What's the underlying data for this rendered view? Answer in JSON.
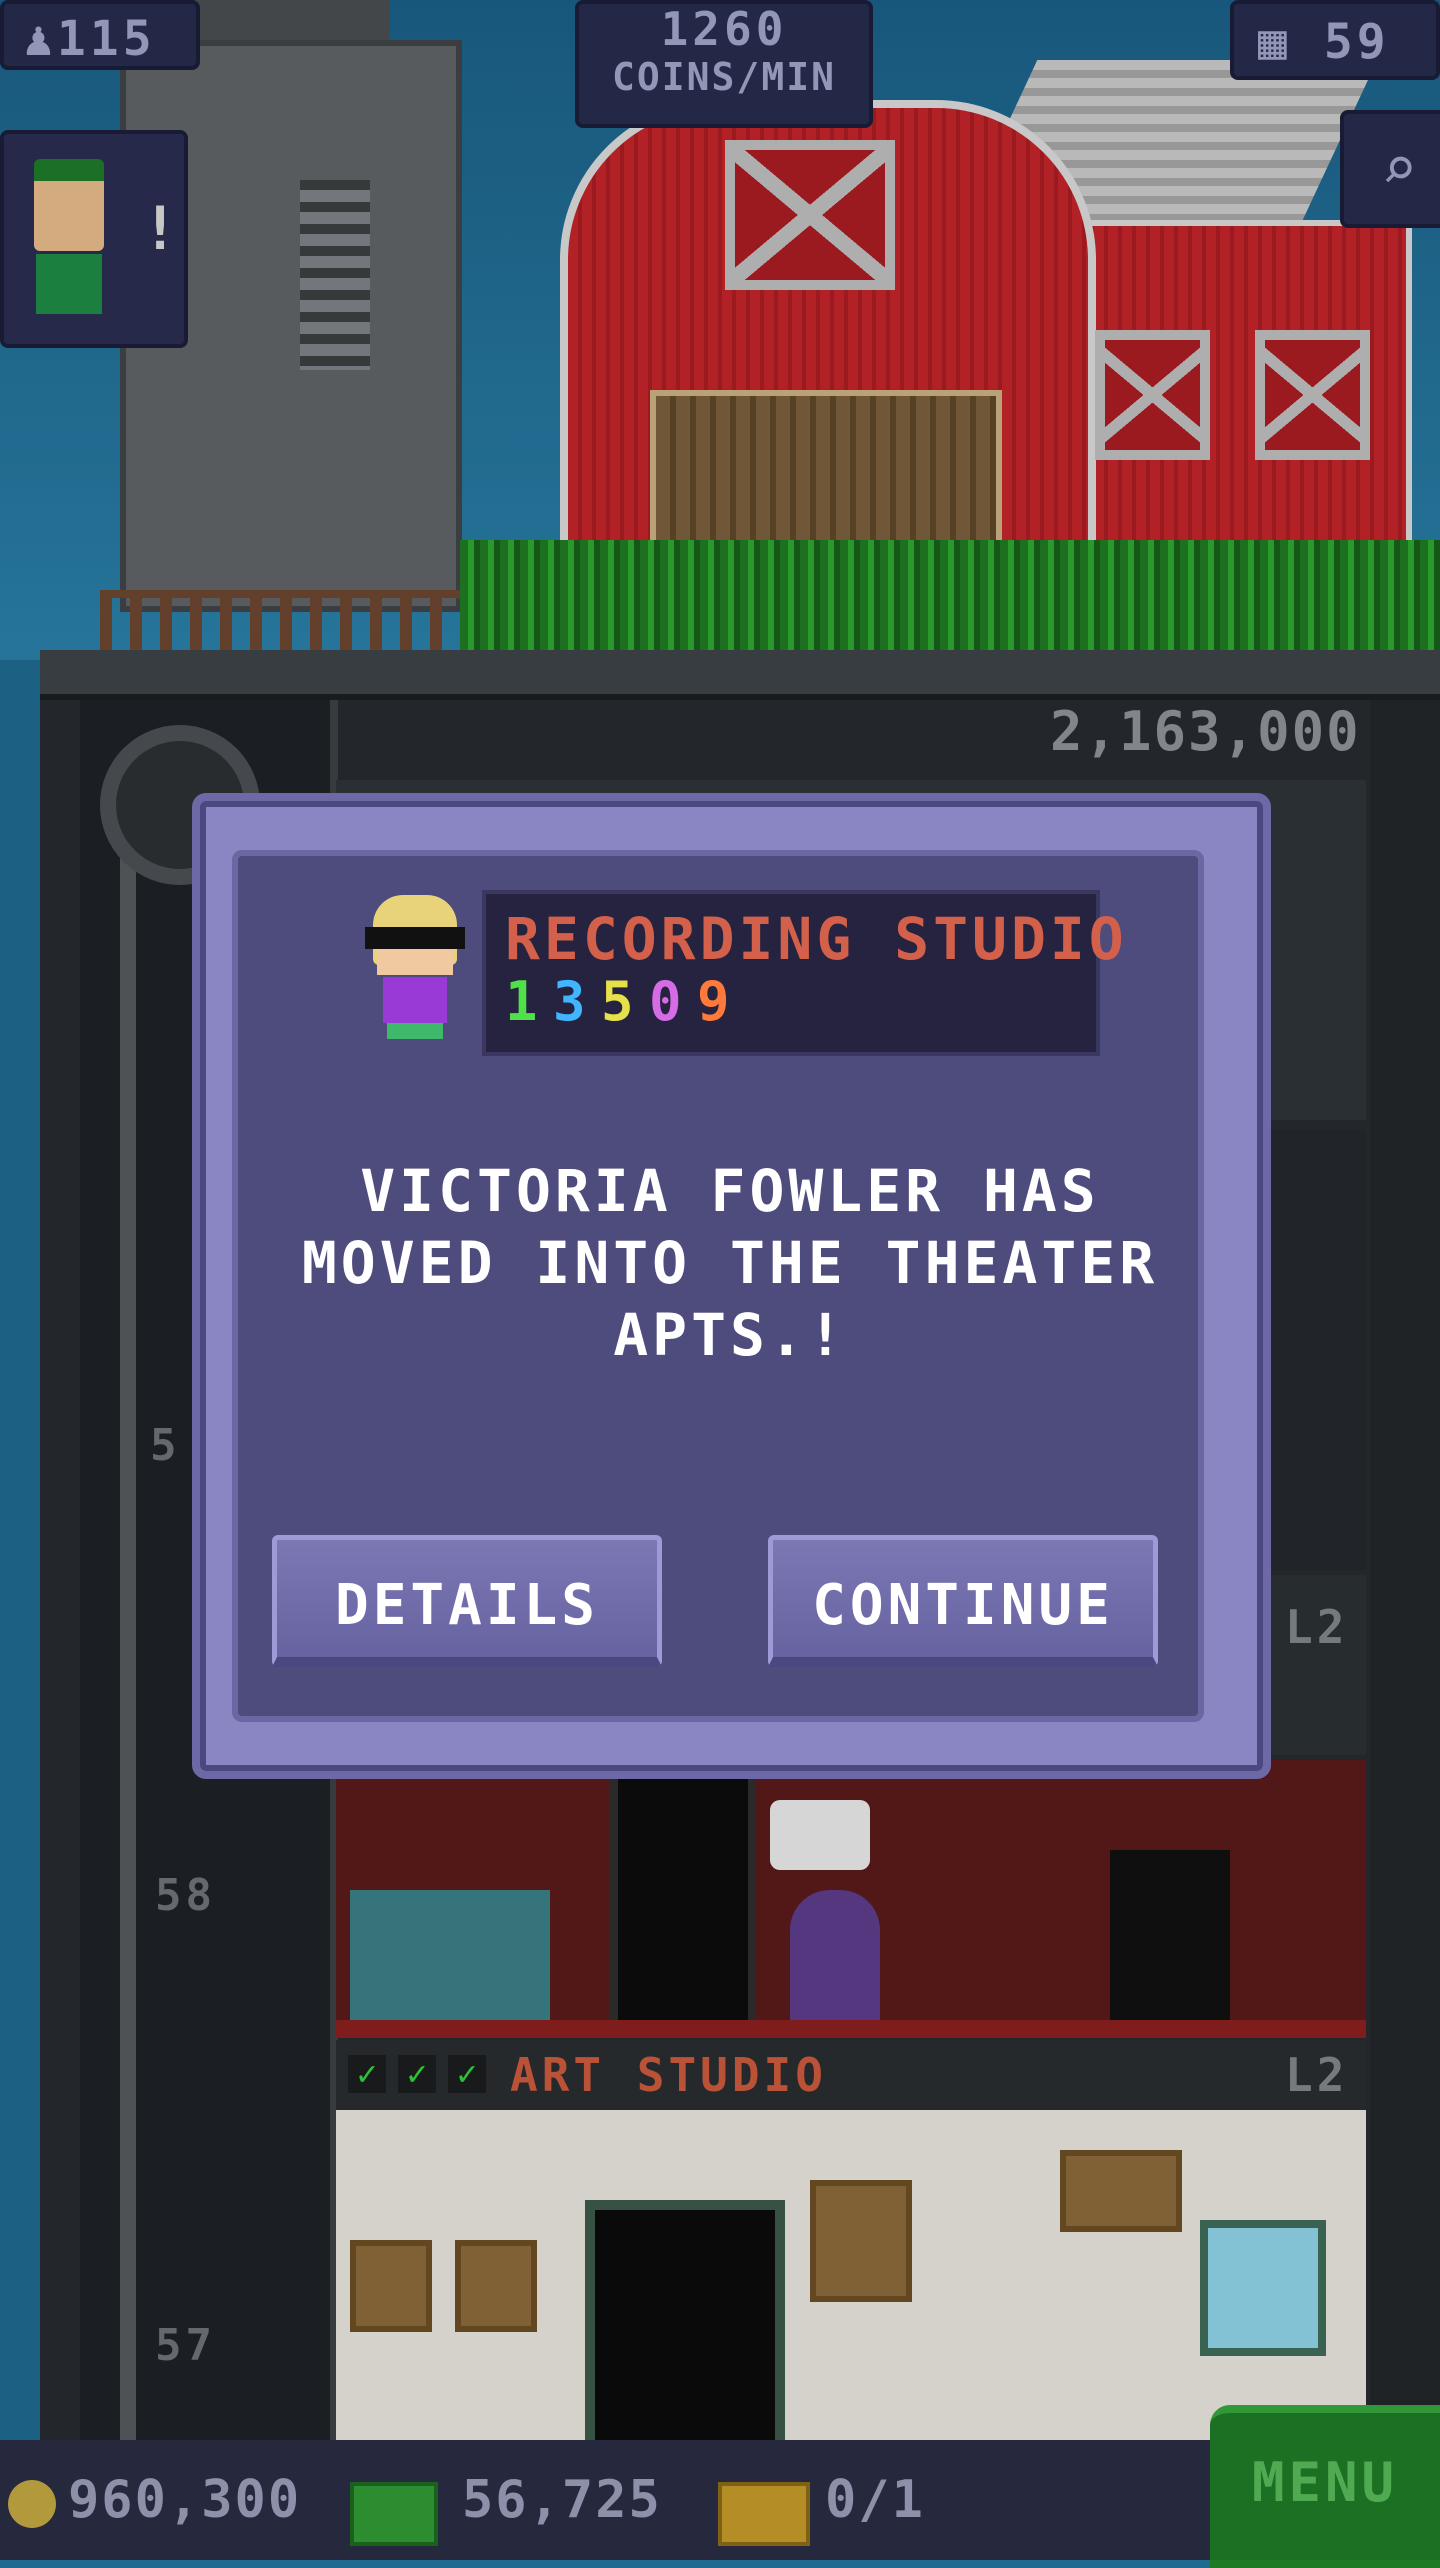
{
  "hud": {
    "population": "115",
    "coins_per_min_value": "1260",
    "coins_per_min_label": "COINS/MIN",
    "floors": "59",
    "coins": "960,300",
    "bux": "56,725",
    "tickets": "0/1",
    "menu": "MENU"
  },
  "tower": {
    "cost_label": "2,163,000",
    "floor_numbers": [
      "5",
      "58",
      "57"
    ],
    "level_labels": [
      "L2",
      "L2"
    ],
    "lower_room_name": "ART STUDIO"
  },
  "dialog": {
    "room_name": "RECORDING STUDIO",
    "digits": [
      "1",
      "3",
      "5",
      "0",
      "9"
    ],
    "digit_colors": [
      "#4fe04a",
      "#3fb6ff",
      "#e6e04a",
      "#d66be6",
      "#ff7a3a"
    ],
    "message_lines": [
      "VICTORIA FOWLER HAS",
      "MOVED INTO THE THEATER",
      "APTS.!"
    ],
    "details_button": "DETAILS",
    "continue_button": "CONTINUE"
  }
}
